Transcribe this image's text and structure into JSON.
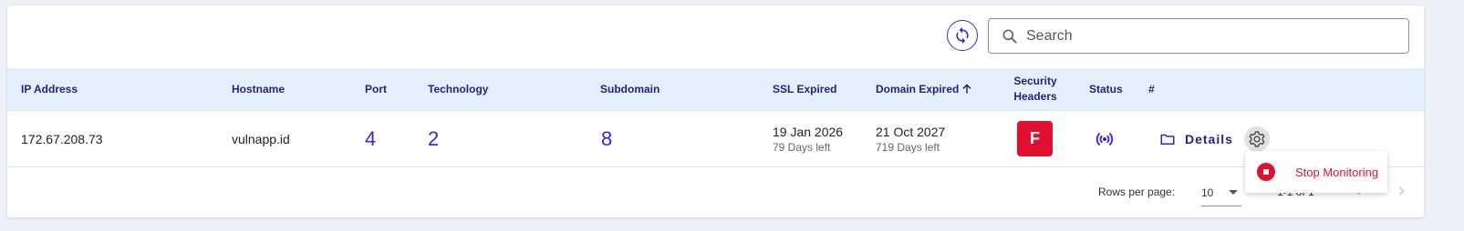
{
  "toolbar": {
    "refresh_icon": "refresh-icon",
    "search": {
      "placeholder": "Search",
      "value": "",
      "icon": "search-icon"
    }
  },
  "table": {
    "columns": [
      {
        "key": "ip",
        "label": "IP Address"
      },
      {
        "key": "hostname",
        "label": "Hostname"
      },
      {
        "key": "port",
        "label": "Port"
      },
      {
        "key": "technology",
        "label": "Technology"
      },
      {
        "key": "subdomain",
        "label": "Subdomain"
      },
      {
        "key": "ssl",
        "label": "SSL Expired"
      },
      {
        "key": "domain",
        "label": "Domain Expired"
      },
      {
        "key": "security_line1",
        "label": "Security"
      },
      {
        "key": "security_line2",
        "label": "Headers"
      },
      {
        "key": "status",
        "label": "Status"
      },
      {
        "key": "actions",
        "label": "#"
      }
    ],
    "sort": {
      "column": "Domain Expired",
      "direction": "ascending",
      "icon": "arrow-up-icon"
    },
    "rows": [
      {
        "ip": "172.67.208.73",
        "hostname": "vulnapp.id",
        "port": "4",
        "technology": "2",
        "subdomain": "8",
        "ssl_date": "19 Jan 2026",
        "ssl_left": "79 Days left",
        "domain_date": "21 Oct 2027",
        "domain_left": "719 Days left",
        "security_grade": "F",
        "status_icon": "broadcast-icon",
        "details_label": "Details"
      }
    ]
  },
  "menu": {
    "items": [
      {
        "label": "Stop Monitoring",
        "icon": "stop-icon"
      }
    ]
  },
  "pagination": {
    "rows_per_page_label": "Rows per page:",
    "rows_per_page_value": "10",
    "range_text": "1-1 of 1"
  },
  "colors": {
    "accent": "#3d1fd6",
    "header_bg": "#e3effb",
    "danger": "#e0102f"
  }
}
